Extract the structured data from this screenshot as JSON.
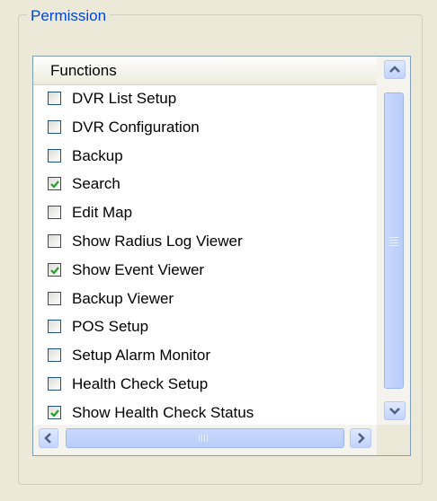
{
  "permission_group": {
    "title": "Permission",
    "list": {
      "column_header": "Functions",
      "items": [
        {
          "label": "DVR List Setup",
          "checked": false
        },
        {
          "label": "DVR Configuration",
          "checked": false
        },
        {
          "label": "Backup",
          "checked": false
        },
        {
          "label": "Search",
          "checked": true
        },
        {
          "label": "Edit Map",
          "checked": false
        },
        {
          "label": "Show Radius Log Viewer",
          "checked": false
        },
        {
          "label": "Show Event Viewer",
          "checked": true
        },
        {
          "label": "Backup Viewer",
          "checked": false
        },
        {
          "label": "POS Setup",
          "checked": false
        },
        {
          "label": "Setup Alarm Monitor",
          "checked": false
        },
        {
          "label": "Health Check Setup",
          "checked": false
        },
        {
          "label": "Show Health Check Status",
          "checked": true
        }
      ]
    }
  },
  "colors": {
    "group_title": "#0046d5",
    "check_mark": "#21a121",
    "checkbox_border": "#1c5180"
  }
}
